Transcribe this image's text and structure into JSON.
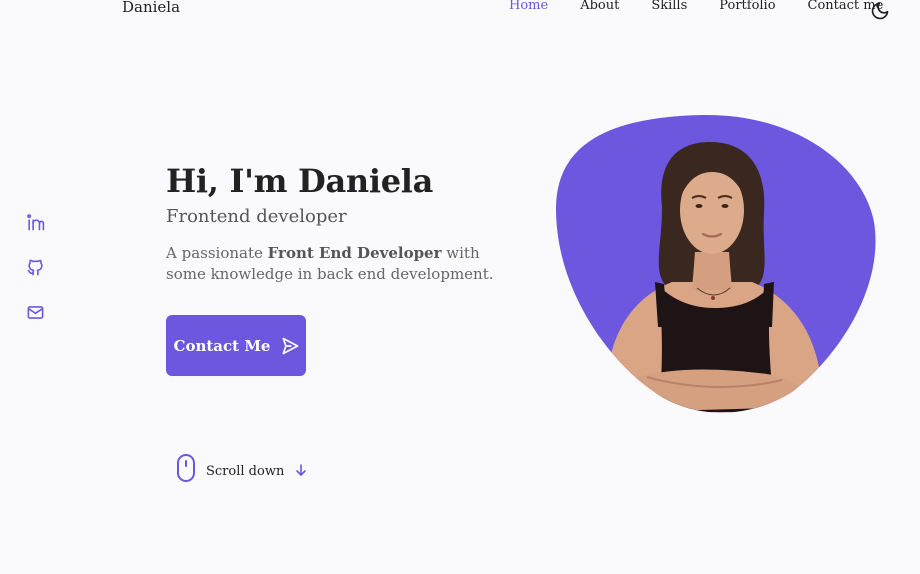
{
  "header": {
    "brand": "Daniela",
    "nav": [
      {
        "label": "Home",
        "active": true
      },
      {
        "label": "About",
        "active": false
      },
      {
        "label": "Skills",
        "active": false
      },
      {
        "label": "Portfolio",
        "active": false
      },
      {
        "label": "Contact me",
        "active": false
      }
    ],
    "theme_toggle_icon": "moon-icon"
  },
  "social": [
    {
      "icon": "linkedin-icon"
    },
    {
      "icon": "github-icon"
    },
    {
      "icon": "mail-icon"
    }
  ],
  "hero": {
    "title": "Hi, I'm Daniela",
    "subtitle": "Frontend developer",
    "desc_before": "A passionate ",
    "desc_bold": "Front End Developer",
    "desc_after": " with some knowledge in back end development.",
    "button_label": "Contact Me",
    "button_icon": "send-icon"
  },
  "scroll": {
    "label": "Scroll down",
    "mouse_icon": "mouse-icon",
    "arrow_icon": "arrow-down-icon"
  },
  "colors": {
    "accent": "#6d57df",
    "background": "#fafafc",
    "text": "#222222"
  }
}
